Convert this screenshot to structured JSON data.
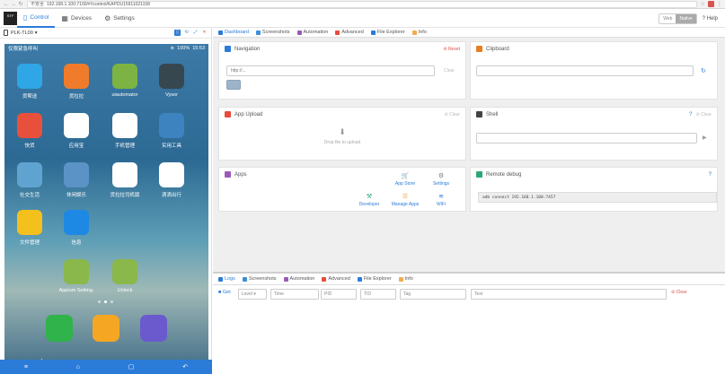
{
  "browser": {
    "insecure_label": "不安全",
    "url": "192.168.1.100:7100/#!/control/KAPDU15911021158",
    "star_icon": "star-icon",
    "menu_icon": "kebab-icon"
  },
  "header": {
    "logo_text": "STF",
    "tabs": [
      {
        "label": "Control",
        "icon": "phone-icon"
      },
      {
        "label": "Devices",
        "icon": "grid-icon"
      },
      {
        "label": "Settings",
        "icon": "gear-icon"
      }
    ],
    "mode_web": "Web",
    "mode_native": "Native",
    "help": "Help"
  },
  "device": {
    "name": "PLK-TL00",
    "statusbar_left": "仅限紧急呼叫",
    "battery": "100%",
    "time": "15:53",
    "apps": [
      {
        "label": "货帮送",
        "color": "#2fa6e6"
      },
      {
        "label": "货拉拉",
        "color": "#f07c2b"
      },
      {
        "label": "uiautomator",
        "color": "#7cb342"
      },
      {
        "label": "Vysor",
        "color": "#37474f"
      },
      {
        "label": "快货",
        "color": "#e9503b"
      },
      {
        "label": "应用宝",
        "color": "#ffffff"
      },
      {
        "label": "手机管理",
        "color": "#ffffff"
      },
      {
        "label": "实用工具",
        "color": "#3c83c0"
      },
      {
        "label": "社交生活",
        "color": "#5fa4d0"
      },
      {
        "label": "休闲娱乐",
        "color": "#5c93c6"
      },
      {
        "label": "货拉拉司机版",
        "color": "#ffffff"
      },
      {
        "label": "滴滴出行",
        "color": "#ffffff"
      },
      {
        "label": "文件管理",
        "color": "#f3c01d"
      },
      {
        "label": "信息",
        "color": "#1e88e5"
      },
      {
        "label": "Appium Setting.",
        "color": "#8ab84a"
      },
      {
        "label": "Unlock",
        "color": "#8ab84a"
      }
    ],
    "dock": [
      "#2fb34a",
      "#f5a623",
      "#6a5acd"
    ]
  },
  "subtabs": [
    "Dashboard",
    "Screenshots",
    "Automation",
    "Advanced",
    "File Explorer",
    "Info"
  ],
  "navigation": {
    "title": "Navigation",
    "reset": "Reset",
    "placeholder": "http://...",
    "clear": "Clear"
  },
  "clipboard": {
    "title": "Clipboard"
  },
  "upload": {
    "title": "App Upload",
    "clear": "Clear",
    "drop": "Drop file to upload"
  },
  "shell": {
    "title": "Shell",
    "clear": "Clear"
  },
  "apps": {
    "title": "Apps",
    "actions": [
      "App Store",
      "Settings",
      "Developer",
      "Manage Apps",
      "WiFi"
    ]
  },
  "remote_debug": {
    "title": "Remote debug",
    "command": "adb connect 192.168.1.100:7457"
  },
  "logs": {
    "tabs": [
      "Logs",
      "Screenshots",
      "Automation",
      "Advanced",
      "File Explorer",
      "Info"
    ],
    "get": "Get",
    "level": "Level",
    "time": "Time",
    "pid": "PID",
    "tid": "TID",
    "tag": "Tag",
    "text": "Text",
    "clear": "Clear"
  }
}
